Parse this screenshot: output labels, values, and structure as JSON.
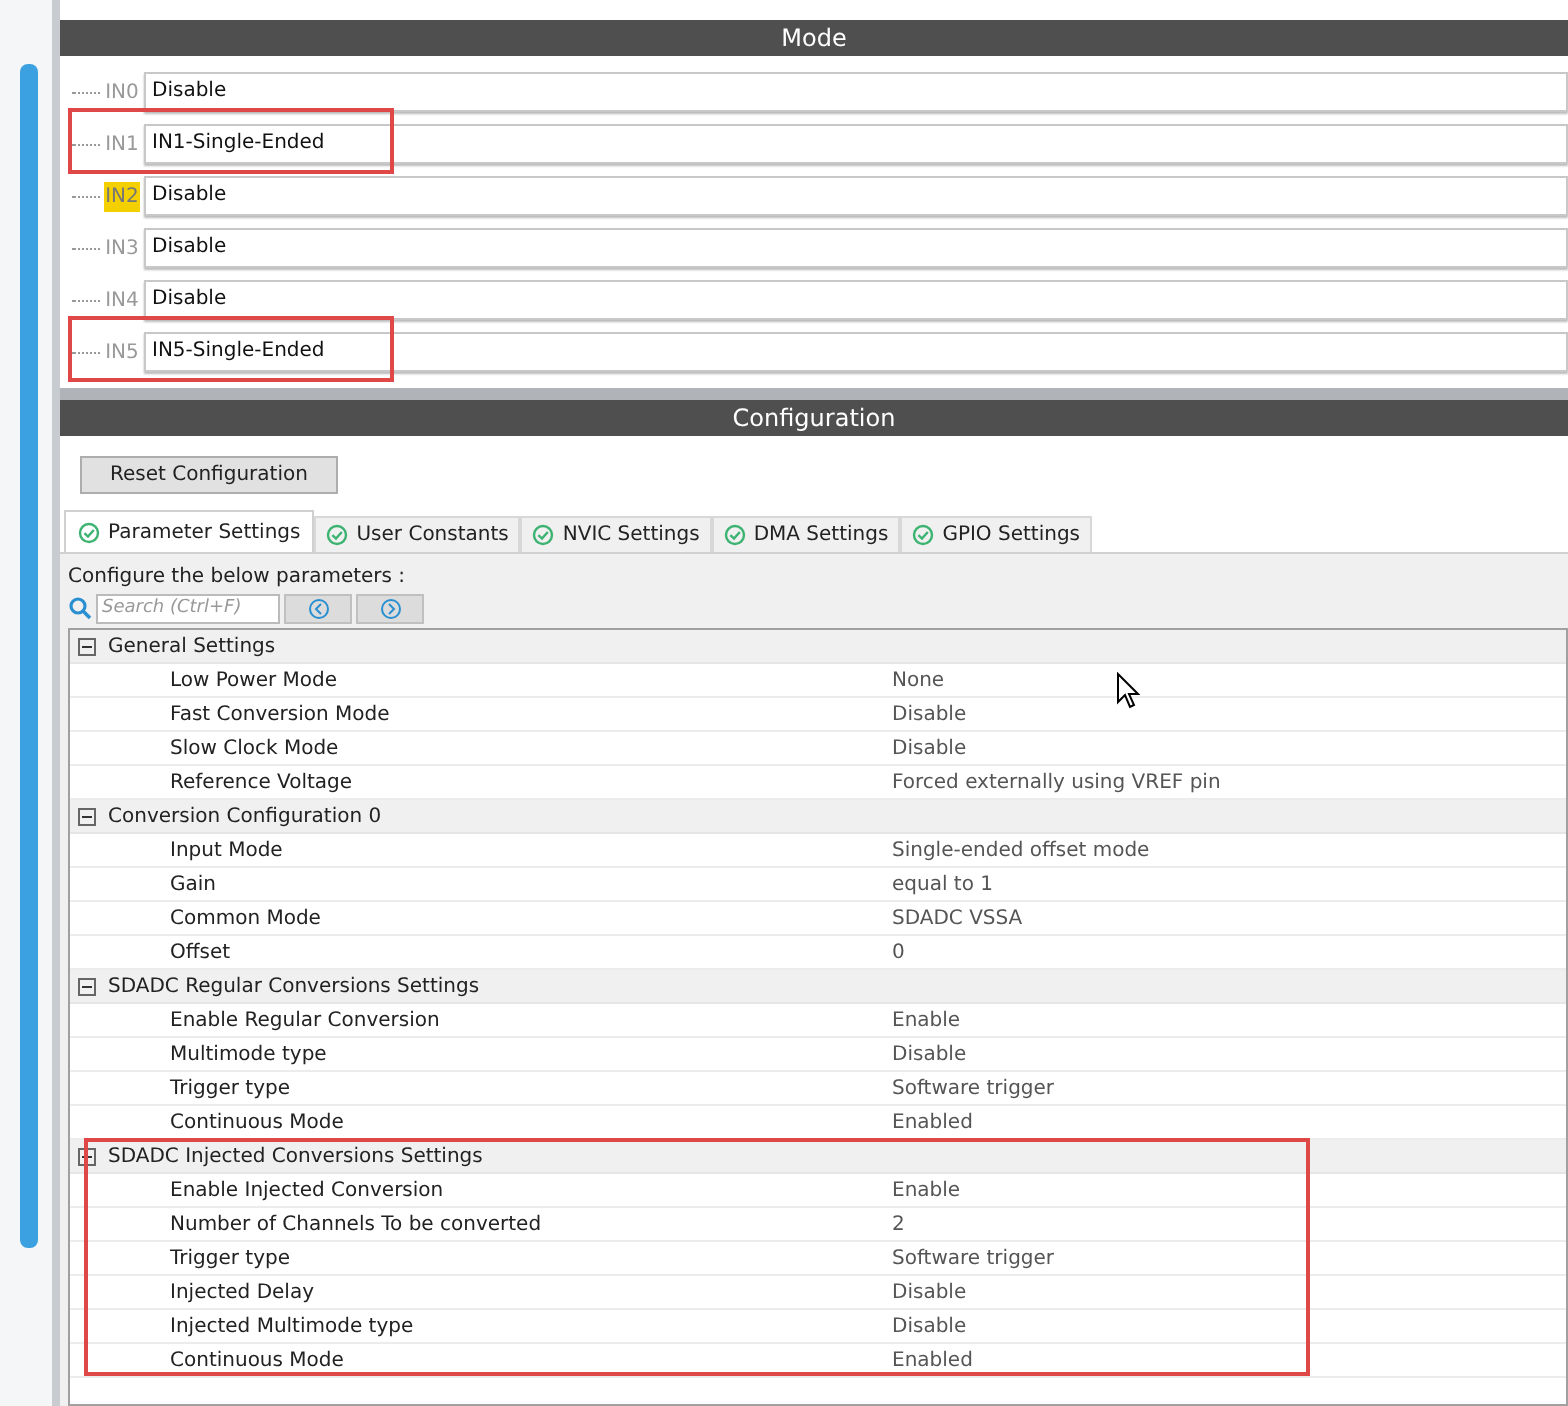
{
  "mode": {
    "title": "Mode",
    "channels": [
      {
        "pin": "IN0",
        "value": "Disable",
        "pin_highlighted": false,
        "annotated": false
      },
      {
        "pin": "IN1",
        "value": "IN1-Single-Ended",
        "pin_highlighted": false,
        "annotated": true
      },
      {
        "pin": "IN2",
        "value": "Disable",
        "pin_highlighted": true,
        "annotated": false
      },
      {
        "pin": "IN3",
        "value": "Disable",
        "pin_highlighted": false,
        "annotated": false
      },
      {
        "pin": "IN4",
        "value": "Disable",
        "pin_highlighted": false,
        "annotated": false
      },
      {
        "pin": "IN5",
        "value": "IN5-Single-Ended",
        "pin_highlighted": false,
        "annotated": true
      }
    ]
  },
  "configuration": {
    "title": "Configuration",
    "reset_button": "Reset Configuration",
    "tabs": [
      {
        "label": "Parameter Settings",
        "selected": true
      },
      {
        "label": "User Constants",
        "selected": false
      },
      {
        "label": "NVIC Settings",
        "selected": false
      },
      {
        "label": "DMA Settings",
        "selected": false
      },
      {
        "label": "GPIO Settings",
        "selected": false
      }
    ],
    "hint": "Configure the below parameters :",
    "search": {
      "placeholder": "Search (Ctrl+F)"
    },
    "groups": [
      {
        "title": "General Settings",
        "expanded": true,
        "annotated": false,
        "params": [
          [
            "Low Power Mode",
            "None"
          ],
          [
            "Fast Conversion Mode",
            "Disable"
          ],
          [
            "Slow Clock Mode",
            "Disable"
          ],
          [
            "Reference Voltage",
            "Forced externally using VREF pin"
          ]
        ]
      },
      {
        "title": "Conversion Configuration 0",
        "expanded": true,
        "annotated": false,
        "params": [
          [
            "Input Mode",
            "Single-ended offset mode"
          ],
          [
            "Gain",
            "equal to 1"
          ],
          [
            "Common Mode",
            "SDADC VSSA"
          ],
          [
            "Offset",
            "0"
          ]
        ]
      },
      {
        "title": "SDADC Regular Conversions Settings",
        "expanded": true,
        "annotated": false,
        "params": [
          [
            "Enable Regular Conversion",
            "Enable"
          ],
          [
            "Multimode type",
            "Disable"
          ],
          [
            "Trigger type",
            "Software trigger"
          ],
          [
            "Continuous Mode",
            "Enabled"
          ]
        ]
      },
      {
        "title": "SDADC Injected Conversions Settings",
        "expanded": true,
        "annotated": true,
        "params": [
          [
            "Enable Injected Conversion",
            "Enable"
          ],
          [
            "Number of Channels To be converted",
            "2"
          ],
          [
            "Trigger type",
            "Software trigger"
          ],
          [
            "Injected Delay",
            "Disable"
          ],
          [
            "Injected Multimode type",
            "Disable"
          ],
          [
            "Continuous Mode",
            "Enabled"
          ]
        ]
      }
    ]
  }
}
